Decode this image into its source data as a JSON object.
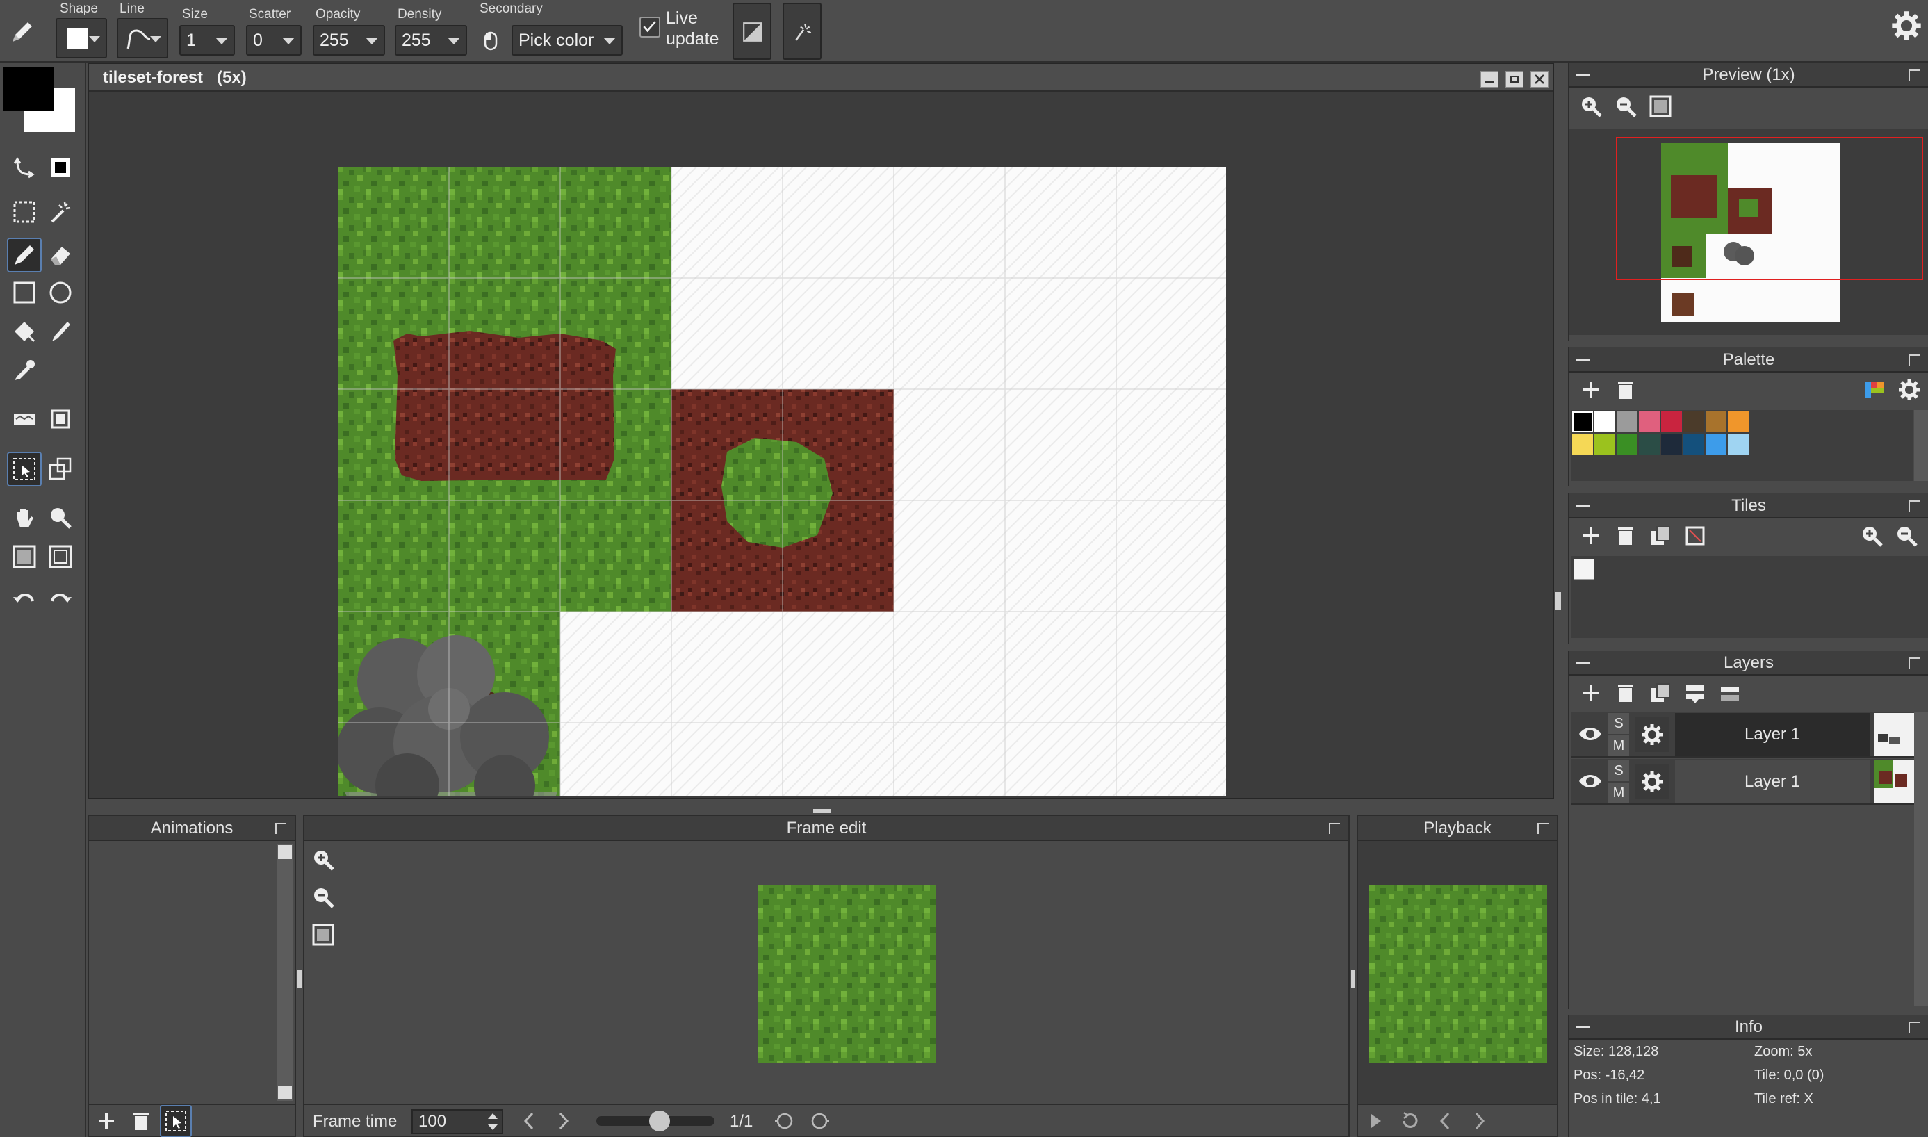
{
  "toolbar": {
    "shape_label": "Shape",
    "line_label": "Line",
    "size_label": "Size",
    "size_value": "1",
    "scatter_label": "Scatter",
    "scatter_value": "0",
    "opacity_label": "Opacity",
    "opacity_value": "255",
    "density_label": "Density",
    "density_value": "255",
    "secondary_label": "Secondary",
    "secondary_value": "Pick color",
    "live_update_label_1": "Live",
    "live_update_label_2": "update",
    "live_update_checked": true
  },
  "canvas": {
    "title": "tileset-forest",
    "zoom": "(5x)"
  },
  "preview": {
    "title": "Preview (1x)"
  },
  "palette": {
    "title": "Palette",
    "colors": [
      "#000000",
      "#ffffff",
      "#9b9b9b",
      "#e0607e",
      "#c9243f",
      "#4b3b2a",
      "#a8732c",
      "#f0962b",
      "#f5d856",
      "#9bc21e",
      "#3a8f24",
      "#2b4d46",
      "#1e2a3a",
      "#14507c",
      "#3d9cea",
      "#9fd4f2"
    ]
  },
  "tiles": {
    "title": "Tiles"
  },
  "layers": {
    "title": "Layers",
    "items": [
      {
        "name": "Layer 1",
        "s": "S",
        "m": "M"
      },
      {
        "name": "Layer 1",
        "s": "S",
        "m": "M"
      }
    ]
  },
  "info": {
    "title": "Info",
    "size": "Size: 128,128",
    "zoom": "Zoom: 5x",
    "pos": "Pos: -16,42",
    "tile": "Tile: 0,0 (0)",
    "pos_in_tile": "Pos in tile: 4,1",
    "tile_ref": "Tile ref: X"
  },
  "animations": {
    "title": "Animations"
  },
  "frame_edit": {
    "title": "Frame edit",
    "frame_time_label": "Frame time",
    "frame_time_value": "100",
    "frame_counter": "1/1"
  },
  "playback": {
    "title": "Playback"
  }
}
